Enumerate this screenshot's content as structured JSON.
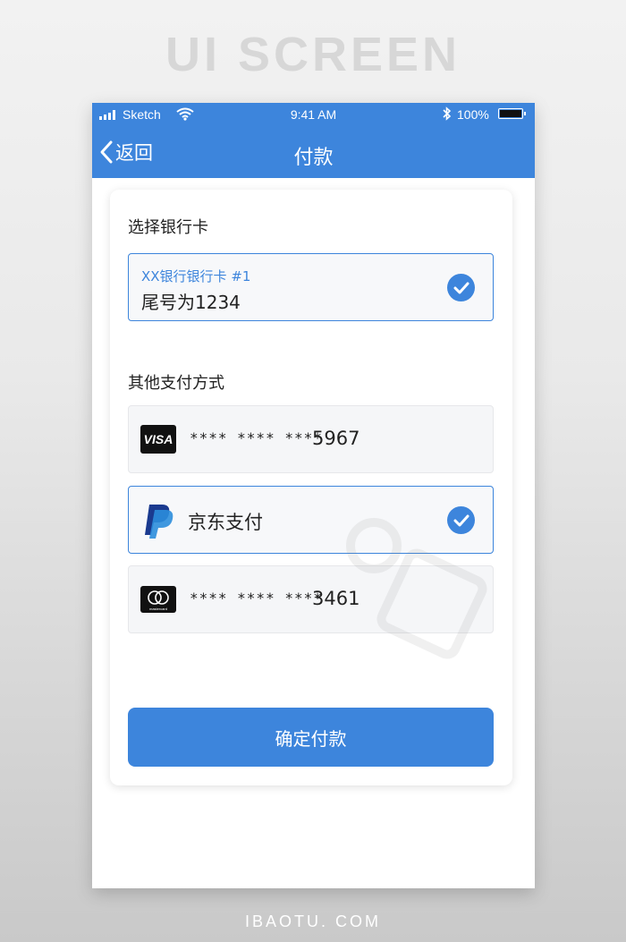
{
  "headline": "UI SCREEN",
  "footer": "IBAOTU. COM",
  "status_bar": {
    "carrier": "Sketch",
    "time": "9:41 AM",
    "battery": "100%"
  },
  "nav": {
    "back_label": "返回",
    "title": "付款"
  },
  "bank_section": {
    "title": "选择银行卡",
    "selected_card": {
      "name": "XX银行银行卡 #1",
      "tail": "尾号为1234"
    }
  },
  "other_section": {
    "title": "其他支付方式",
    "methods": [
      {
        "type": "visa",
        "logo_text": "VISA",
        "mask": "**** **** ****",
        "number": "5967",
        "selected": false
      },
      {
        "type": "paypal",
        "label": "京东支付",
        "selected": true
      },
      {
        "type": "mastercard",
        "logo_text": "mastercard",
        "mask": "**** **** ****",
        "number": "3461",
        "selected": false
      }
    ]
  },
  "confirm_button": "确定付款",
  "colors": {
    "accent": "#3d85dc",
    "option_bg": "#f5f6f8"
  },
  "icons": [
    "signal-icon",
    "wifi-icon",
    "bluetooth-icon",
    "battery-icon",
    "chevron-left-icon",
    "check-icon",
    "visa-logo",
    "paypal-logo",
    "mastercard-logo"
  ]
}
